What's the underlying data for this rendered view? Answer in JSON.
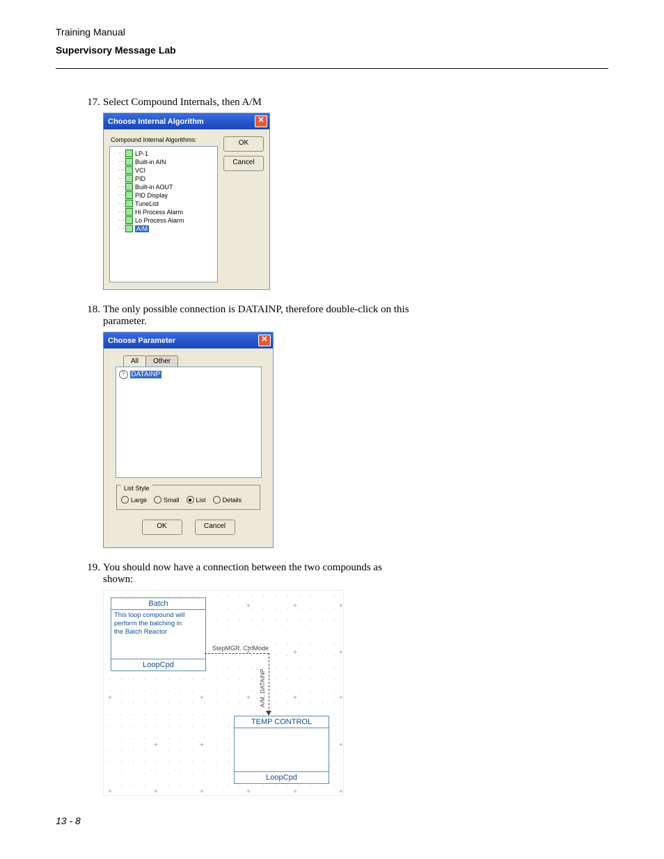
{
  "header": {
    "small": "Training Manual",
    "bold": "Supervisory Message Lab"
  },
  "steps": {
    "s17": {
      "num": "17.",
      "text": "Select Compound Internals, then A/M"
    },
    "s18": {
      "num": "18.",
      "text": "The only possible connection is DATAINP, therefore double-click on this parameter."
    },
    "s19": {
      "num": "19.",
      "text": "You should now have a connection between the two compounds as shown:"
    }
  },
  "dialog1": {
    "title": "Choose Internal Algorithm",
    "treeTitle": "Compound Internal Algorithms:",
    "items": [
      "LP-1",
      "Built-in AIN",
      "VCI",
      "PID",
      "Built-in AOUT",
      "PID Display",
      "TuneList",
      "Hi Process Alarm",
      "Lo Process Alarm",
      "A/M"
    ],
    "ok": "OK",
    "cancel": "Cancel"
  },
  "dialog2": {
    "title": "Choose Parameter",
    "tabs": {
      "all": "All",
      "other": "Other"
    },
    "item": "DATAINP",
    "listStyle": {
      "legend": "List Style",
      "opts": [
        "Large",
        "Small",
        "List",
        "Details"
      ],
      "selected": "List"
    },
    "ok": "OK",
    "cancel": "Cancel"
  },
  "diagram": {
    "batch": {
      "title": "Batch",
      "desc1": "This loop compound will",
      "desc2": "perform the batching in",
      "desc3": "the Batch Reactor",
      "loop": "LoopCpd"
    },
    "temp": {
      "title": "TEMP CONTROL",
      "loop": "LoopCpd"
    },
    "sigH": "StepMGR. CtrlMode",
    "sigV": "A/M. DATAINP"
  },
  "pageNum": "13 - 8"
}
